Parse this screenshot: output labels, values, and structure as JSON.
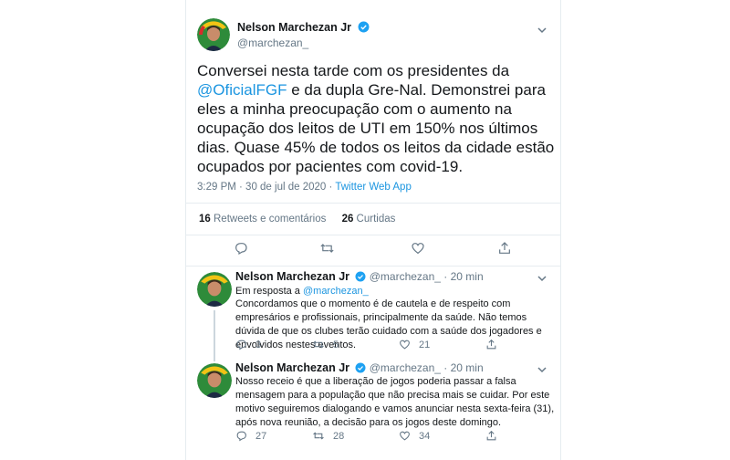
{
  "tweet": {
    "author_name": "Nelson Marchezan Jr",
    "author_handle": "@marchezan_",
    "text_before": "Conversei nesta tarde com os presidentes da ",
    "mention": "@OficialFGF",
    "text_after": " e da dupla Gre-Nal. Demonstrei para eles a minha preocupação com o aumento na ocupação dos leitos de UTI em 150% nos últimos dias. Quase 45% de todos os leitos da cidade estão ocupados por pacientes com covid-19.",
    "time": "3:29 PM · 30 de jul de 2020 · ",
    "source": "Twitter Web App",
    "retweets_count": "16",
    "retweets_label": " Retweets e comentários",
    "likes_count": "26",
    "likes_label": " Curtidas"
  },
  "replies": [
    {
      "author_name": "Nelson Marchezan Jr",
      "author_handle": "@marchezan_",
      "time": "· 20 min",
      "reply_to_label": "Em resposta a ",
      "reply_to_handle": "@marchezan_",
      "text": "Concordamos que o momento é de cautela e de respeito com empresários e profissionais, principalmente da saúde. Não temos dúvida de que os clubes terão cuidado com a saúde dos jogadores e envolvidos nestes eventos.",
      "replies": "3",
      "retweets": "5",
      "likes": "21"
    },
    {
      "author_name": "Nelson Marchezan Jr",
      "author_handle": "@marchezan_",
      "time": "· 20 min",
      "text": "Nosso receio é que a liberação de jogos poderia passar a falsa mensagem para a população que não precisa mais se cuidar. Por este motivo seguiremos dialogando e vamos anunciar nesta sexta-feira (31), após nova reunião, a decisão para os jogos deste domingo.",
      "replies": "27",
      "retweets": "28",
      "likes": "34"
    }
  ],
  "colors": {
    "link": "#1b95e0",
    "muted": "#657786",
    "verified": "#1da1f2"
  },
  "icons": [
    "verified-badge-icon",
    "chevron-down-icon",
    "reply-icon",
    "retweet-icon",
    "like-icon",
    "share-icon",
    "avatar-image"
  ]
}
